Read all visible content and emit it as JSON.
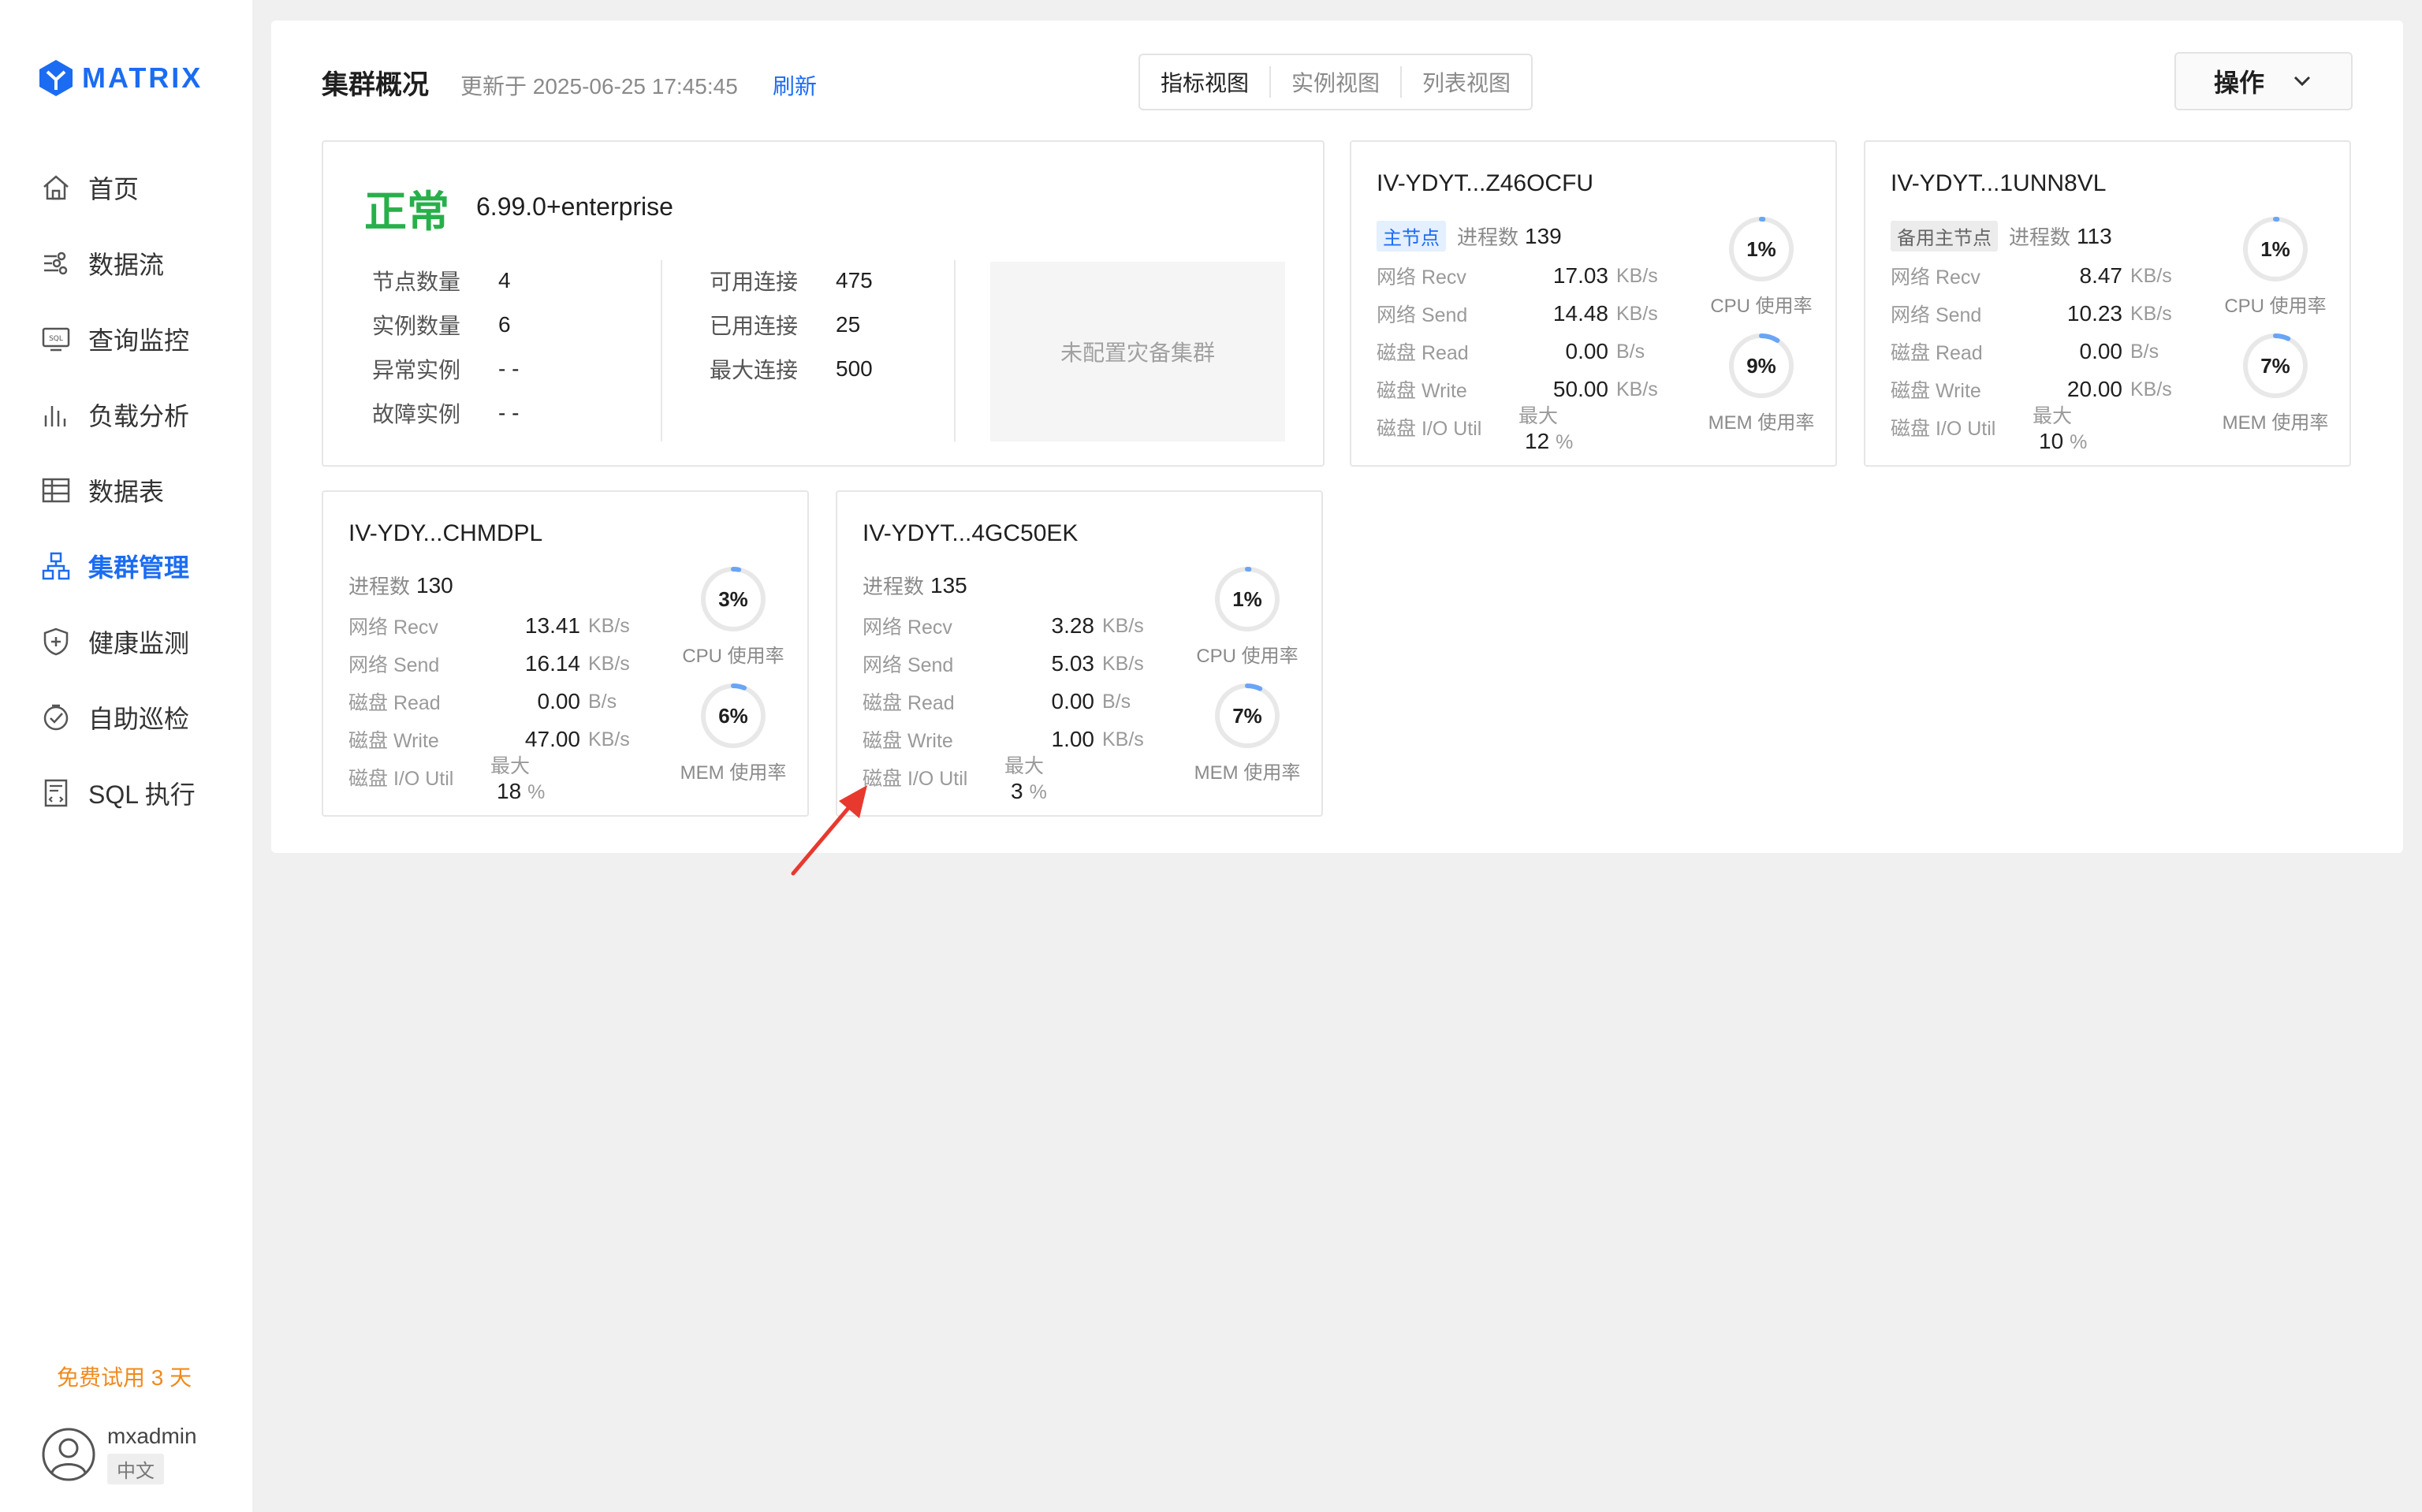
{
  "brand": {
    "name": "MATRIX",
    "color": "#1b6cf2"
  },
  "nav": [
    {
      "label": "首页",
      "icon": "home-icon"
    },
    {
      "label": "数据流",
      "icon": "dataflow-icon"
    },
    {
      "label": "查询监控",
      "icon": "sql-monitor-icon"
    },
    {
      "label": "负载分析",
      "icon": "bar-chart-icon"
    },
    {
      "label": "数据表",
      "icon": "table-icon"
    },
    {
      "label": "集群管理",
      "icon": "cluster-icon",
      "active": true
    },
    {
      "label": "健康监测",
      "icon": "shield-icon"
    },
    {
      "label": "自助巡检",
      "icon": "inspection-icon"
    },
    {
      "label": "SQL 执行",
      "icon": "sql-file-icon"
    }
  ],
  "trial": "免费试用 3 天",
  "user": {
    "name": "mxadmin",
    "lang": "中文"
  },
  "header": {
    "title": "集群概况",
    "updated": "更新于 2025-06-25 17:45:45",
    "refresh": "刷新",
    "tabs": [
      "指标视图",
      "实例视图",
      "列表视图"
    ],
    "ops": "操作"
  },
  "summary": {
    "status": "正常",
    "status_color": "#27b04a",
    "version": "6.99.0+enterprise",
    "left": [
      {
        "label": "节点数量",
        "value": "4"
      },
      {
        "label": "实例数量",
        "value": "6"
      },
      {
        "label": "异常实例",
        "value": "- -"
      },
      {
        "label": "故障实例",
        "value": "- -"
      }
    ],
    "right": [
      {
        "label": "可用连接",
        "value": "475"
      },
      {
        "label": "已用连接",
        "value": "25"
      },
      {
        "label": "最大连接",
        "value": "500"
      }
    ],
    "dr": "未配置灾备集群"
  },
  "labels": {
    "proc": "进程数",
    "recv": "网络 Recv",
    "send": "网络 Send",
    "read": "磁盘 Read",
    "write": "磁盘 Write",
    "io": "磁盘 I/O Util",
    "max": "最大",
    "pct": "%",
    "cpu": "CPU 使用率",
    "mem": "MEM 使用率"
  },
  "nodes": [
    {
      "name": "IV-YDYT...Z46OCFU",
      "tag": "主节点",
      "tag_type": "primary",
      "proc": "139",
      "recv": "17.03",
      "recv_u": "KB/s",
      "send": "14.48",
      "send_u": "KB/s",
      "read": "0.00",
      "read_u": "B/s",
      "write": "50.00",
      "write_u": "KB/s",
      "io": "12",
      "cpu": "1%",
      "cpu_v": 1,
      "mem": "9%",
      "mem_v": 9
    },
    {
      "name": "IV-YDYT...1UNN8VL",
      "tag": "备用主节点",
      "tag_type": "backup",
      "proc": "113",
      "recv": "8.47",
      "recv_u": "KB/s",
      "send": "10.23",
      "send_u": "KB/s",
      "read": "0.00",
      "read_u": "B/s",
      "write": "20.00",
      "write_u": "KB/s",
      "io": "10",
      "cpu": "1%",
      "cpu_v": 1,
      "mem": "7%",
      "mem_v": 7
    },
    {
      "name": "IV-YDY...CHMDPL",
      "tag": "",
      "tag_type": "",
      "proc": "130",
      "recv": "13.41",
      "recv_u": "KB/s",
      "send": "16.14",
      "send_u": "KB/s",
      "read": "0.00",
      "read_u": "B/s",
      "write": "47.00",
      "write_u": "KB/s",
      "io": "18",
      "cpu": "3%",
      "cpu_v": 3,
      "mem": "6%",
      "mem_v": 6
    },
    {
      "name": "IV-YDYT...4GC50EK",
      "tag": "",
      "tag_type": "",
      "proc": "135",
      "recv": "3.28",
      "recv_u": "KB/s",
      "send": "5.03",
      "send_u": "KB/s",
      "read": "0.00",
      "read_u": "B/s",
      "write": "1.00",
      "write_u": "KB/s",
      "io": "3",
      "cpu": "1%",
      "cpu_v": 1,
      "mem": "7%",
      "mem_v": 7
    }
  ],
  "gauge_colors": {
    "track": "#e8e8e8",
    "fill": "#6aa5f5"
  },
  "annotation_color": "#e8392f"
}
